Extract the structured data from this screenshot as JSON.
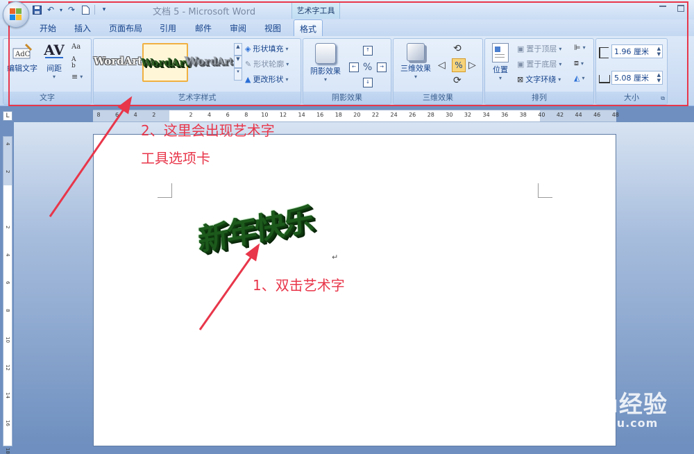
{
  "window": {
    "title": "文档 5 - Microsoft Word",
    "context_tab_group": "艺术字工具"
  },
  "tabs": [
    "开始",
    "插入",
    "页面布局",
    "引用",
    "邮件",
    "审阅",
    "视图",
    "格式"
  ],
  "active_tab": "格式",
  "ribbon": {
    "text_group": {
      "label": "文字",
      "edit_text": "编辑文字",
      "spacing": "间距"
    },
    "wordart_styles_group": {
      "label": "艺术字样式",
      "gallery": [
        "WordArt",
        "WordArt",
        "WordArt"
      ],
      "shape_fill": "形状填充",
      "shape_outline": "形状轮廓",
      "change_shape": "更改形状"
    },
    "shadow_group": {
      "label": "阴影效果",
      "shadow_effects": "阴影效果"
    },
    "threed_group": {
      "label": "三维效果",
      "threed_effects": "三维效果"
    },
    "arrange_group": {
      "label": "排列",
      "position": "位置",
      "bring_to_front": "置于顶层",
      "send_to_back": "置于底层",
      "text_wrapping": "文字环绕"
    },
    "size_group": {
      "label": "大小",
      "height": "1.96 厘米",
      "width": "5.08 厘米"
    }
  },
  "ruler": {
    "horizontal": [
      "8",
      "6",
      "4",
      "2",
      "",
      "2",
      "4",
      "6",
      "8",
      "10",
      "12",
      "14",
      "16",
      "18",
      "20",
      "22",
      "24",
      "26",
      "28",
      "30",
      "32",
      "34",
      "36",
      "38",
      "40",
      "42",
      "44",
      "46",
      "48"
    ],
    "vertical": [
      "4",
      "2",
      "",
      "2",
      "4",
      "6",
      "8",
      "10",
      "12",
      "14",
      "16",
      "18"
    ]
  },
  "document": {
    "wordart_text": "新年快乐",
    "paragraph_mark": "↵"
  },
  "annotations": {
    "step2_line1": "2、这里会出现艺术字",
    "step2_line2": "工具选项卡",
    "step1": "1、双击艺术字"
  },
  "watermark": {
    "brand": "Bai du经验",
    "url": "jingyan.baidu.com"
  },
  "colors": {
    "annotation": "#e8364a",
    "wordart": "#1c5a1c",
    "ribbon": "#dbe8f8"
  }
}
